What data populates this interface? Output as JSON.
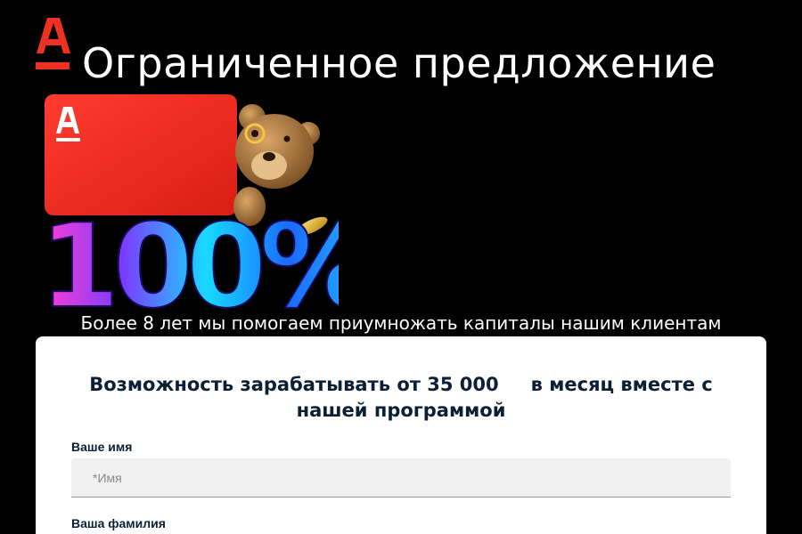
{
  "header": {
    "logo_icon": "alfa-bank-logo-icon",
    "brand_color": "#ef3124",
    "title": "Ограниченное предложение"
  },
  "hero": {
    "card_icon": "alfa-bank-card-icon",
    "mascot_icon": "teddy-bear-icon",
    "coin_icon": "coin-icon",
    "badge_text": "100%"
  },
  "tagline": "Более 8 лет мы помогаем приумножать капиталы нашим клиентам",
  "form": {
    "offer_line1_a": "Возможность зарабатывать от 35 000",
    "offer_line1_b": "в месяц вместе с",
    "offer_line2": "нашей программой",
    "fields": [
      {
        "label": "Ваше имя",
        "placeholder": "*Имя",
        "value": ""
      },
      {
        "label": "Ваша фамилия",
        "placeholder": "",
        "value": ""
      }
    ]
  }
}
